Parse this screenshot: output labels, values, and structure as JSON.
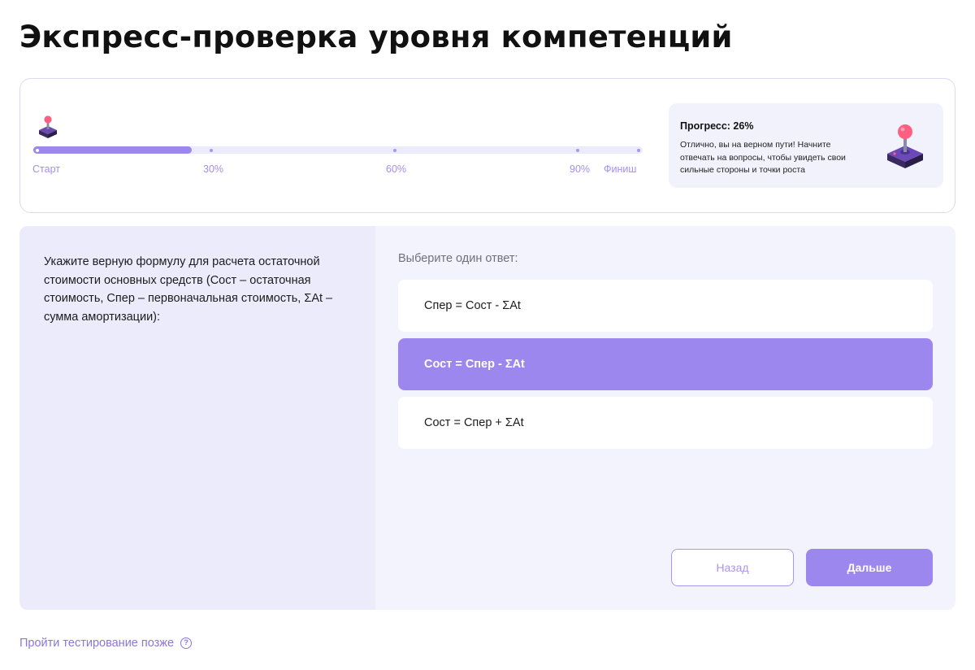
{
  "page": {
    "title": "Экспресс-проверка уровня компетенций"
  },
  "progress": {
    "percent": 26,
    "labels": {
      "start": "Старт",
      "p30": "30%",
      "p60": "60%",
      "p90": "90%",
      "finish": "Финиш"
    },
    "title": "Прогресс: 26%",
    "text": "Отлично, вы на верном пути! Начните отвечать на вопросы, чтобы увидеть свои сильные стороны и точки роста",
    "icon": "joystick-icon"
  },
  "question": {
    "text": "Укажите верную формулу для расчета остаточной стоимости основных средств (Сост – остаточная стоимость, Спер – первоначальная стоимость, ΣAt – сумма амортизации):",
    "hint": "Выберите один ответ:",
    "options": [
      {
        "label": "Спер = Сост - ΣAt",
        "selected": false
      },
      {
        "label": "Сост = Спер - ΣAt",
        "selected": true
      },
      {
        "label": "Сост = Спер + ΣAt",
        "selected": false
      }
    ]
  },
  "buttons": {
    "back": "Назад",
    "next": "Дальше"
  },
  "footer": {
    "later_link": "Пройти тестирование позже",
    "help_icon": "question-circle-icon"
  },
  "colors": {
    "accent": "#9c87ee",
    "track": "#ecebfb",
    "panel": "#f3f3fe"
  }
}
